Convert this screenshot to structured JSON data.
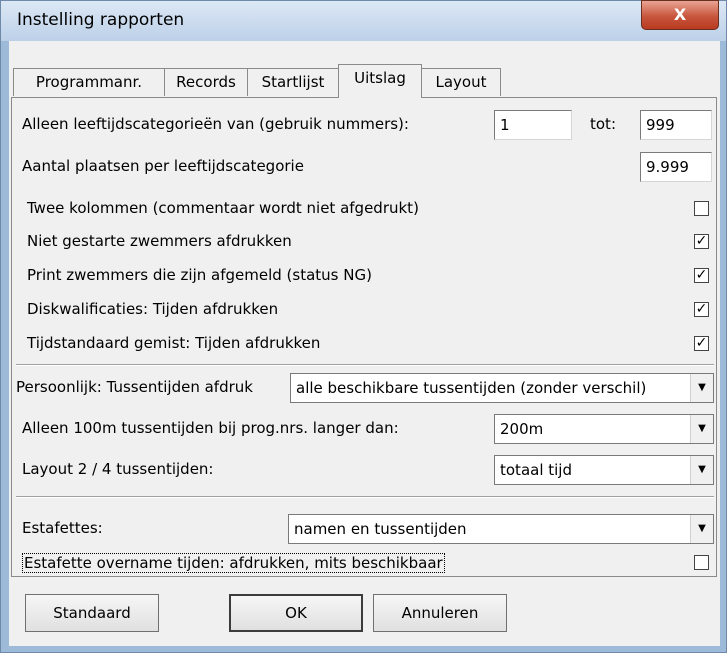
{
  "window": {
    "title": "Instelling rapporten",
    "close_symbol": "X"
  },
  "tabs": [
    "Programmanr.",
    "Records",
    "Startlijst",
    "Uitslag",
    "Layout"
  ],
  "active_tab": "Uitslag",
  "age_range": {
    "label": "Alleen leeftijdscategorieën van (gebruik nummers):",
    "from": "1",
    "to_label": "tot:",
    "to": "999"
  },
  "places": {
    "label": "Aantal plaatsen per leeftijdscategorie",
    "value": "9.999"
  },
  "checkboxes": [
    {
      "label": "Twee kolommen (commentaar wordt niet afgedrukt)",
      "checked": false,
      "mark": ""
    },
    {
      "label": "Niet gestarte zwemmers afdrukken",
      "checked": true,
      "mark": "✓"
    },
    {
      "label": "Print zwemmers die zijn afgemeld (status NG)",
      "checked": true,
      "mark": "✓"
    },
    {
      "label": "Diskwalificaties: Tijden afdrukken",
      "checked": true,
      "mark": "✓"
    },
    {
      "label": "Tijdstandaard gemist: Tijden afdrukken",
      "checked": true,
      "mark": "✓"
    }
  ],
  "splits": {
    "personal_label": "Persoonlijk: Tussentijden afdruk",
    "personal_value": "alle beschikbare tussentijden (zonder verschil)",
    "only100_label": "Alleen 100m tussentijden bij prog.nrs. langer dan:",
    "only100_value": "200m",
    "layout_label": "Layout 2 / 4 tussentijden:",
    "layout_value": "totaal tijd"
  },
  "relays": {
    "label": "Estafettes:",
    "value": "namen en tussentijden",
    "takeover_label": "Estafette overname tijden: afdrukken, mits beschikbaar",
    "takeover_checked": false,
    "takeover_mark": ""
  },
  "buttons": {
    "standard": "Standaard",
    "ok": "OK",
    "cancel": "Annuleren"
  },
  "dropdown_arrow": "▼"
}
